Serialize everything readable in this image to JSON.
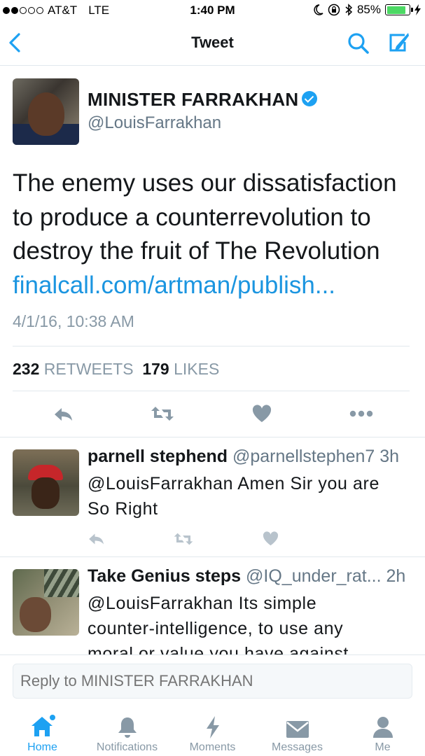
{
  "status_bar": {
    "carrier": "AT&T",
    "network": "LTE",
    "time": "1:40 PM",
    "battery": "85%",
    "battery_level": 0.85
  },
  "nav": {
    "title": "Tweet",
    "back_icon": "chevron-left-icon",
    "search_icon": "search-icon",
    "compose_icon": "compose-icon"
  },
  "tweet": {
    "name": "MINISTER FARRAKHAN",
    "handle": "@LouisFarrakhan",
    "verified": true,
    "lines": [
      "The enemy uses our dissatisfaction",
      "to produce a counterrevolution to",
      "destroy the fruit of The Revolution"
    ],
    "link": "finalcall.com/artman/publish...",
    "timestamp": "4/1/16, 10:38 AM",
    "retweets_count": "232",
    "retweets_label": "RETWEETS",
    "likes_count": "179",
    "likes_label": "LIKES"
  },
  "replies": [
    {
      "name": "parnell stephend",
      "handle": "@parnellstephen7",
      "time": "3h",
      "lines": [
        "@LouisFarrakhan Amen Sir you are",
        "So Right"
      ]
    },
    {
      "name": "Take Genius steps",
      "handle": "@IQ_under_rat...",
      "time": "2h",
      "lines": [
        "@LouisFarrakhan Its simple",
        "counter-intelligence, to use any",
        "moral or value you have against"
      ]
    }
  ],
  "compose": {
    "placeholder": "Reply to MINISTER FARRAKHAN"
  },
  "tabs": [
    {
      "label": "Home",
      "icon": "home-icon",
      "active": true
    },
    {
      "label": "Notifications",
      "icon": "bell-icon",
      "active": false
    },
    {
      "label": "Moments",
      "icon": "lightning-icon",
      "active": false
    },
    {
      "label": "Messages",
      "icon": "envelope-icon",
      "active": false
    },
    {
      "label": "Me",
      "icon": "person-icon",
      "active": false
    }
  ],
  "colors": {
    "accent": "#1da1f2",
    "link": "#1b95e0",
    "muted": "#8899a6",
    "action_icon": "#8899a6"
  }
}
